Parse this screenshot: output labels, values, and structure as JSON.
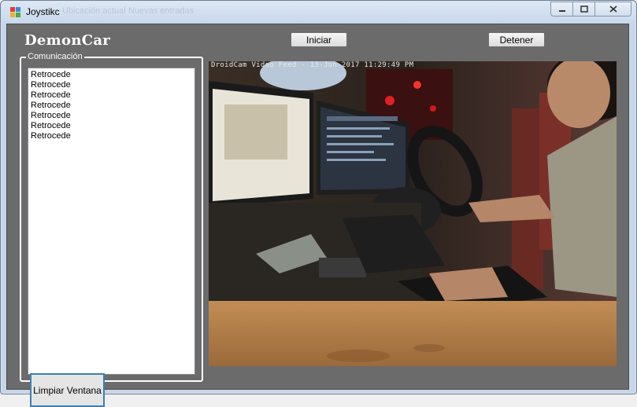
{
  "window": {
    "title": "Joystikc",
    "ghost_left": "Ubicación actual",
    "ghost_right": "Nuevas entradas"
  },
  "app": {
    "brand": "DemonCar",
    "buttons": {
      "start": "Iniciar",
      "stop": "Detener",
      "clear": "Limpiar Ventana"
    }
  },
  "communication": {
    "legend": "Comunicación",
    "log": [
      "Retrocede",
      "Retrocede",
      "Retrocede",
      "Retrocede",
      "Retrocede",
      "Retrocede",
      "Retrocede"
    ]
  },
  "video": {
    "overlay": "DroidCam Video Feed - 13-Jun-2017 11:29:49 PM"
  },
  "colors": {
    "client_bg": "#6b6b6b",
    "accent_border": "#3c7fb1"
  }
}
